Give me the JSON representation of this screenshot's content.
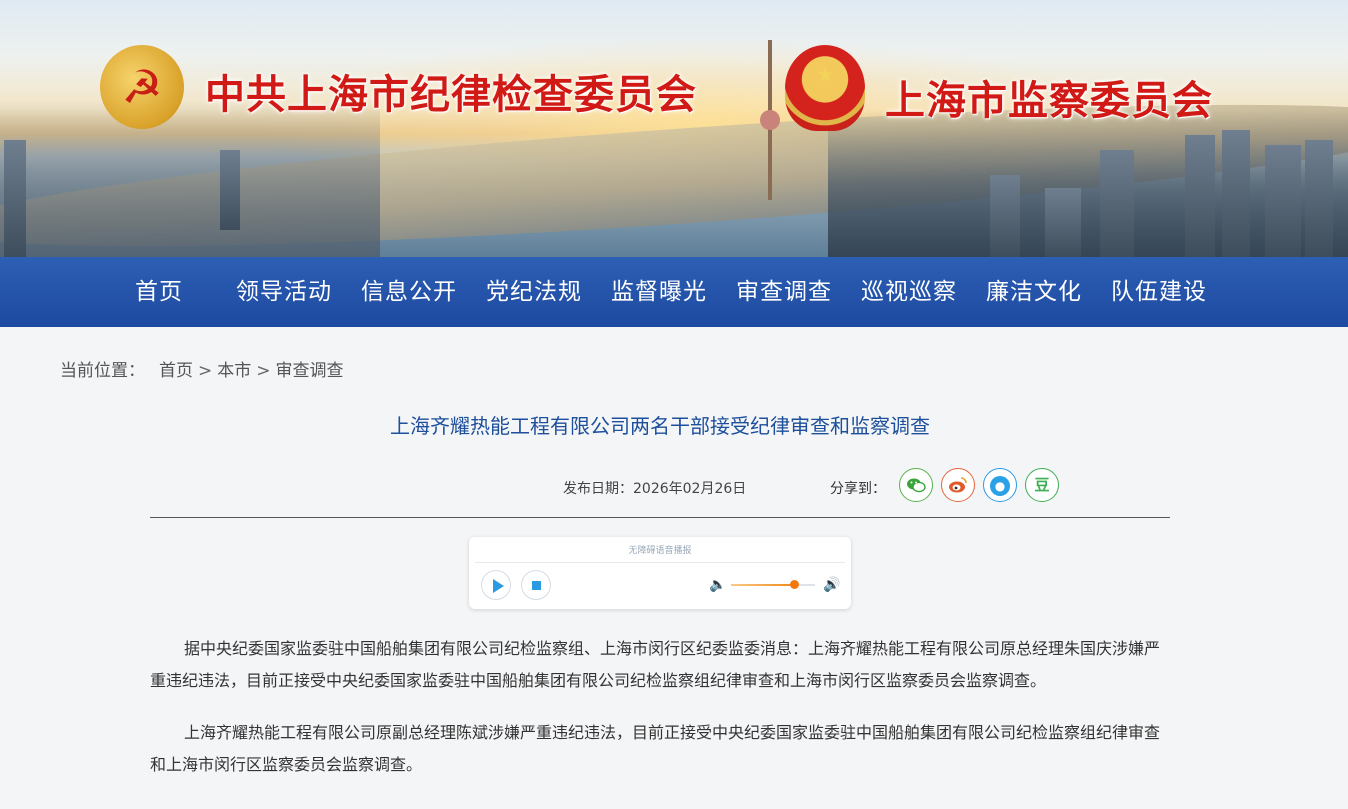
{
  "header": {
    "cpc_title": "中共上海市纪律检查委员会",
    "sv_title": "上海市监察委员会",
    "party_emblem_icon": "party-emblem-icon",
    "national_emblem_icon": "national-emblem-icon"
  },
  "nav": {
    "items": [
      {
        "label": "首页"
      },
      {
        "label": "领导活动"
      },
      {
        "label": "信息公开"
      },
      {
        "label": "党纪法规"
      },
      {
        "label": "监督曝光"
      },
      {
        "label": "审查调查"
      },
      {
        "label": "巡视巡察"
      },
      {
        "label": "廉洁文化"
      },
      {
        "label": "队伍建设"
      }
    ],
    "color": "#1f4ca3"
  },
  "breadcrumb": {
    "label": "当前位置：",
    "items": [
      "首页",
      "本市",
      "审查调查"
    ],
    "separator": ">"
  },
  "article": {
    "title": "上海齐耀热能工程有限公司两名干部接受纪律审查和监察调查",
    "publish_label": "发布日期：",
    "publish_date": "2026年02月26日",
    "share_label": "分享到：",
    "share_icons": [
      "wechat-icon",
      "weibo-icon",
      "qq-icon",
      "douban-icon"
    ],
    "douban_glyph": "豆",
    "paragraphs": [
      "据中央纪委国家监委驻中国船舶集团有限公司纪检监察组、上海市闵行区纪委监委消息：上海齐耀热能工程有限公司原总经理朱国庆涉嫌严重违纪违法，目前正接受中央纪委国家监委驻中国船舶集团有限公司纪检监察组纪律审查和上海市闵行区监察委员会监察调查。",
      "上海齐耀热能工程有限公司原副总经理陈斌涉嫌严重违纪违法，目前正接受中央纪委国家监委驻中国船舶集团有限公司纪检监察组纪律审查和上海市闵行区监察委员会监察调查。"
    ]
  },
  "player": {
    "caption": "无障碍语音播报",
    "volume_level": 0.75
  },
  "colors": {
    "title_red": "#d11a15",
    "article_title_blue": "#1d4f9c",
    "accent_orange": "#f07a10",
    "accent_blue": "#2a9be0"
  }
}
